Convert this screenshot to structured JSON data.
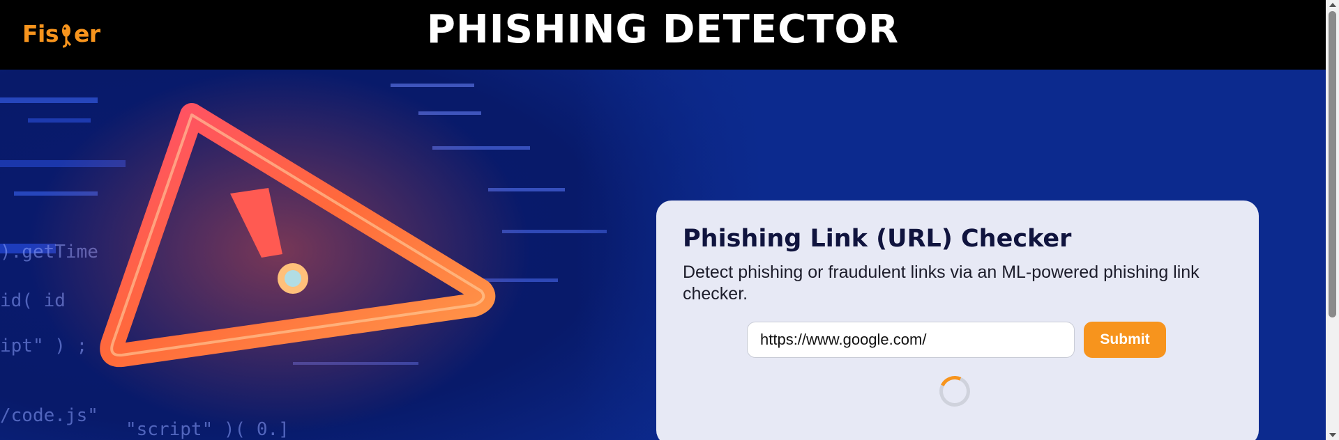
{
  "header": {
    "logo_text_left": "Fis",
    "logo_text_right": "er",
    "title": "PHISHING DETECTOR"
  },
  "card": {
    "title": "Phishing Link (URL) Checker",
    "description": "Detect phishing or fraudulent links via an ML-powered phishing link checker."
  },
  "form": {
    "url_value": "https://www.google.com/",
    "submit_label": "Submit"
  },
  "status": {
    "loading": true
  },
  "colors": {
    "brand_orange": "#f7941d",
    "header_bg": "#000000",
    "hero_bg": "#0c2a8e",
    "card_bg": "#e7e9f5"
  },
  "icons": {
    "logo_fish": "fish-hook-icon",
    "hero_warning": "warning-triangle-icon",
    "spinner": "loading-spinner-icon"
  }
}
